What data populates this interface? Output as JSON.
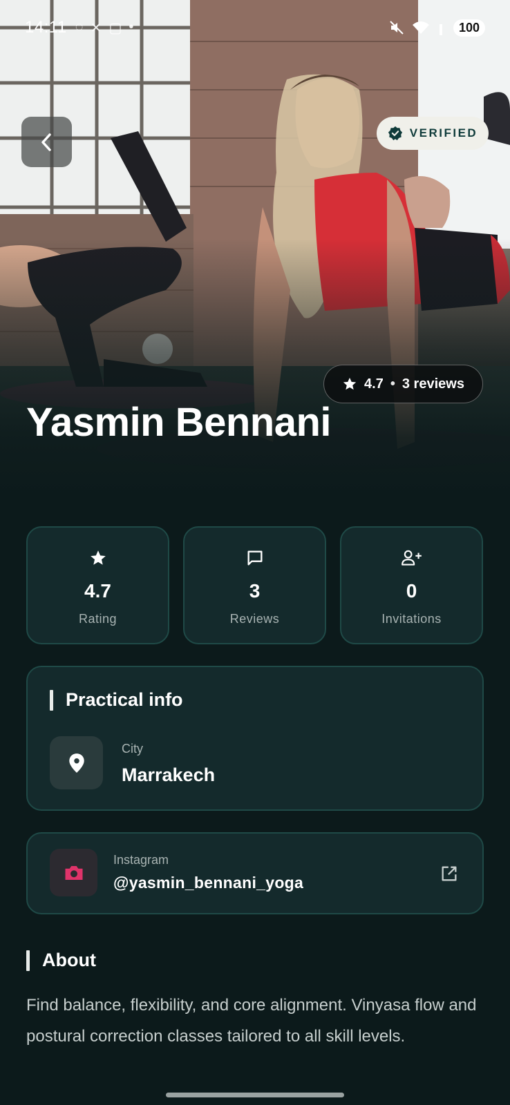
{
  "status_bar": {
    "time": "14:11",
    "battery": "100",
    "left_icons": [
      "whatsapp-icon",
      "x-icon",
      "screenshot-icon",
      "dot-icon"
    ],
    "right_icons": [
      "mute-icon",
      "wifi-icon",
      "signal-icon"
    ]
  },
  "hero": {
    "verified_label": "VERIFIED",
    "rating": "4.7",
    "reviews_label": "3 reviews",
    "name": "Yasmin Bennani"
  },
  "stats": [
    {
      "icon": "star-icon",
      "value": "4.7",
      "label": "Rating"
    },
    {
      "icon": "chat-icon",
      "value": "3",
      "label": "Reviews"
    },
    {
      "icon": "add-user-icon",
      "value": "0",
      "label": "Invitations"
    }
  ],
  "practical_info": {
    "title": "Practical info",
    "city_label": "City",
    "city_value": "Marrakech"
  },
  "instagram": {
    "label": "Instagram",
    "handle": "@yasmin_bennani_yoga"
  },
  "about": {
    "title": "About",
    "text": "Find balance, flexibility, and core alignment. Vinyasa flow and postural correction classes tailored to all skill levels."
  },
  "colors": {
    "background": "#0c1a1b",
    "card": "#142a2c",
    "card_border": "#1f4a47",
    "verified_text": "#0f3b3a",
    "instagram_accent": "#e0336a"
  }
}
